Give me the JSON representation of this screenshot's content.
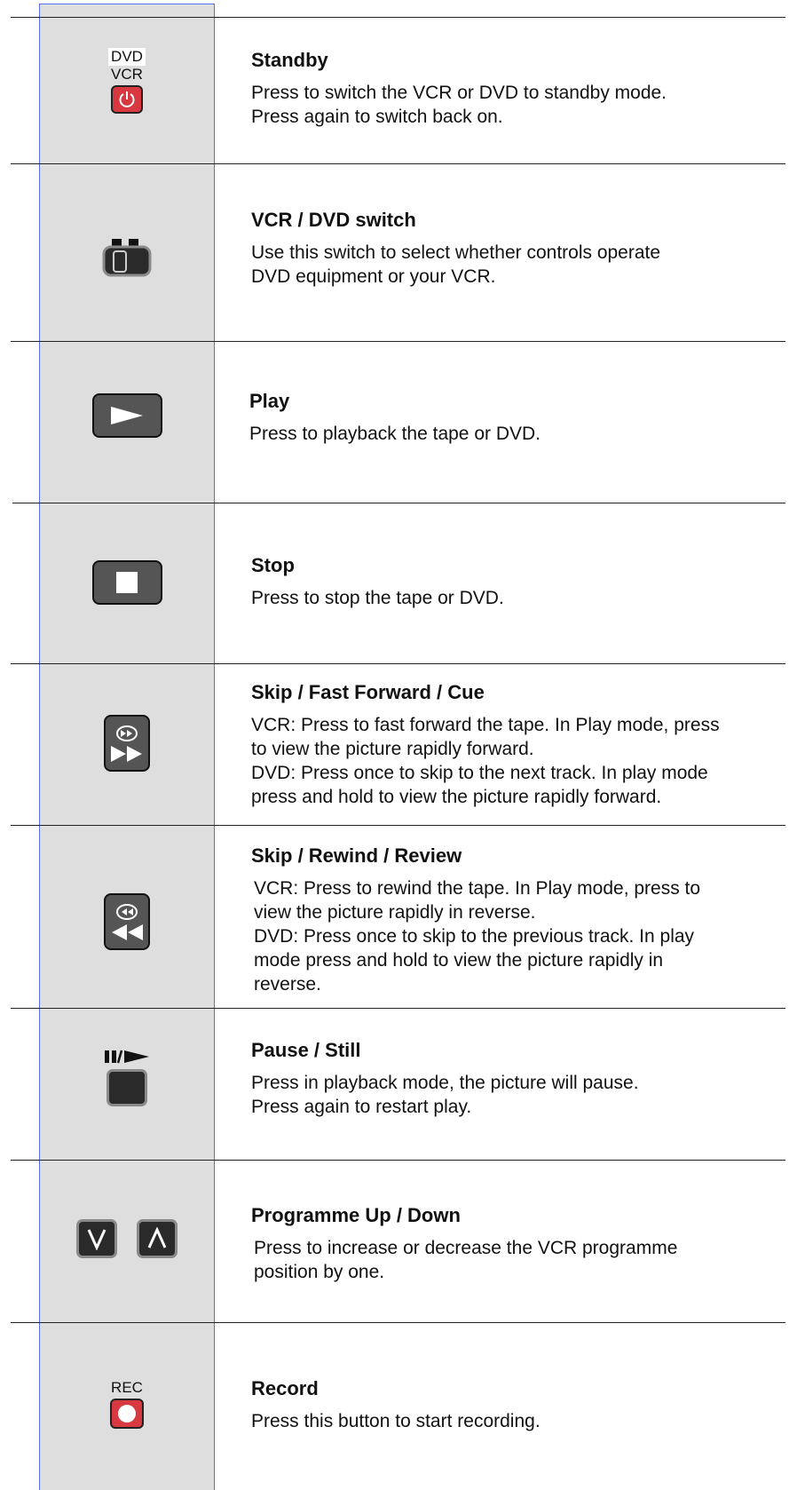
{
  "icons": {
    "standby_label_top": "DVD",
    "standby_label_bottom": "VCR",
    "pause_label": "II/►",
    "record_label": "REC"
  },
  "rows": [
    {
      "title": "Standby",
      "text": "Press to switch the VCR or DVD to standby mode.\nPress again to switch back on.",
      "icon": "power-icon"
    },
    {
      "title": "VCR / DVD switch",
      "text": "Use this switch to select whether controls operate\nDVD equipment or your VCR.",
      "icon": "switch-icon"
    },
    {
      "title": "Play",
      "text": "Press to playback the tape or DVD.",
      "icon": "play-icon"
    },
    {
      "title": "Stop",
      "text": "Press to stop the tape or DVD.",
      "icon": "stop-icon"
    },
    {
      "title": "Skip / Fast Forward / Cue",
      "text": "VCR: Press to fast forward the tape. In Play mode, press\nto view the picture rapidly forward.\nDVD: Press once to skip to the next track.  In play mode\npress and hold to view the picture rapidly forward.",
      "icon": "fast-forward-icon"
    },
    {
      "title": "Skip / Rewind / Review",
      "text": "VCR: Press to rewind the tape. In Play mode, press to\nview the picture rapidly in reverse.\nDVD: Press once to skip to the previous track.  In play\nmode press and hold to view the picture rapidly in\nreverse.",
      "icon": "rewind-icon"
    },
    {
      "title": "Pause / Still",
      "text": "Press in playback mode, the picture will pause.\nPress again to restart play.",
      "icon": "pause-icon"
    },
    {
      "title": "Programme Up / Down",
      "text": "Press to increase or decrease the VCR programme\nposition by one.",
      "icon": "chevron-icons"
    },
    {
      "title": "Record",
      "text": "Press this button to start recording.",
      "icon": "record-icon"
    }
  ],
  "colors": {
    "icon_column": "#dedede",
    "column_border": "#5b6ef0",
    "standby_red": "#d8383f",
    "record_red": "#d8383f"
  }
}
